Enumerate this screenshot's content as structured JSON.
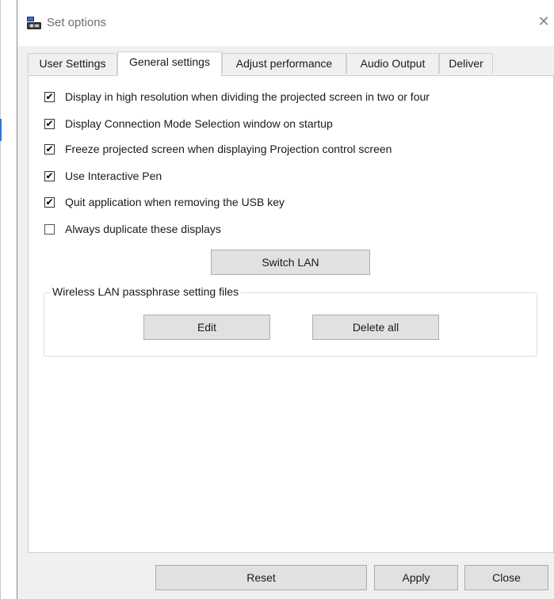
{
  "window": {
    "title": "Set options",
    "close_glyph": "✕"
  },
  "tabs": [
    {
      "label": "User Settings",
      "active": false
    },
    {
      "label": "General settings",
      "active": true
    },
    {
      "label": "Adjust performance",
      "active": false
    },
    {
      "label": "Audio Output",
      "active": false
    },
    {
      "label": "Deliver",
      "active": false
    }
  ],
  "general": {
    "options": [
      {
        "label": "Display in high resolution when dividing the projected screen in two or four",
        "checked": true
      },
      {
        "label": "Display Connection Mode Selection window on startup",
        "checked": true
      },
      {
        "label": "Freeze projected screen when displaying Projection control screen",
        "checked": true
      },
      {
        "label": "Use Interactive Pen",
        "checked": true
      },
      {
        "label": "Quit application when removing the USB key",
        "checked": true
      },
      {
        "label": "Always duplicate these displays",
        "checked": false
      }
    ],
    "switch_lan_label": "Switch LAN",
    "wireless_group": {
      "legend": "Wireless LAN passphrase setting files",
      "edit_label": "Edit",
      "delete_all_label": "Delete all"
    }
  },
  "footer": {
    "reset_label": "Reset",
    "apply_label": "Apply",
    "close_label": "Close"
  },
  "checkmark_glyph": "✔",
  "colors": {
    "button_bg": "#e1e1e1",
    "button_border": "#adadad",
    "panel_bg": "#ffffff",
    "window_bg": "#f0f0f0"
  }
}
